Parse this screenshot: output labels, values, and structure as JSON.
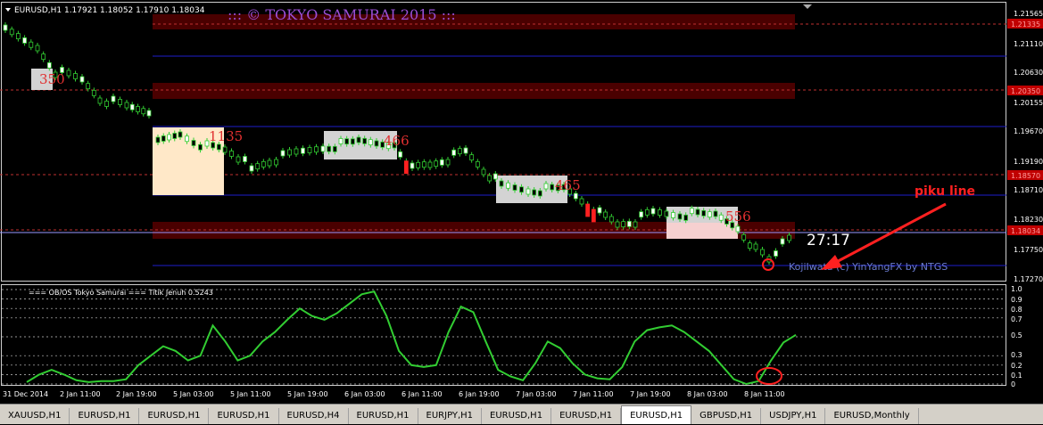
{
  "chart_header": {
    "title": "EURUSD,H1  1.17921 1.18052 1.17910 1.18034",
    "watermark": "::: © TOKYO SAMURAI 2015 :::",
    "menu_icon": "triangle-down-icon"
  },
  "price_axis": {
    "labels": [
      "1.21565",
      "1.21110",
      "1.20630",
      "1.20155",
      "1.19670",
      "1.19190",
      "1.18710",
      "1.18230",
      "1.17750",
      "1.17270"
    ],
    "badges": [
      "1.21335",
      "1.20350",
      "1.18570",
      "1.18034"
    ]
  },
  "box_labels": [
    "350",
    "1135",
    "466",
    "465",
    "556"
  ],
  "countdown": "27:17",
  "credit": "KojiIwata (c) YinYangFX by NTGS",
  "annotation": {
    "text": "piku line",
    "arrow_icon": "red-arrow-icon"
  },
  "indicator": {
    "title": "=== OB/OS Tokyo Samurai === Titik Jenuh 0.5243",
    "scale_labels": [
      "1.0",
      "0.9",
      "0.8",
      "0.7",
      "0.5",
      "0.3",
      "0.2",
      "0.1",
      "0"
    ],
    "level_markers": [
      1.0,
      0.9,
      0.8,
      0.7,
      0.5,
      0.3,
      0.2,
      0.1,
      0
    ],
    "line_color": "#32cd32",
    "curve": [
      0.02,
      0.1,
      0.15,
      0.1,
      0.04,
      0.02,
      0.03,
      0.03,
      0.05,
      0.2,
      0.3,
      0.4,
      0.35,
      0.25,
      0.3,
      0.62,
      0.45,
      0.25,
      0.3,
      0.45,
      0.55,
      0.68,
      0.8,
      0.72,
      0.68,
      0.75,
      0.85,
      0.95,
      0.98,
      0.72,
      0.35,
      0.2,
      0.18,
      0.2,
      0.55,
      0.82,
      0.76,
      0.45,
      0.15,
      0.08,
      0.04,
      0.22,
      0.45,
      0.38,
      0.22,
      0.1,
      0.06,
      0.05,
      0.18,
      0.45,
      0.57,
      0.6,
      0.62,
      0.55,
      0.45,
      0.35,
      0.2,
      0.05,
      0.0,
      0.03,
      0.25,
      0.44,
      0.52
    ]
  },
  "time_axis": [
    "31 Dec 2014",
    "2 Jan 11:00",
    "2 Jan 19:00",
    "5 Jan 03:00",
    "5 Jan 11:00",
    "5 Jan 19:00",
    "6 Jan 03:00",
    "6 Jan 11:00",
    "6 Jan 19:00",
    "7 Jan 03:00",
    "7 Jan 11:00",
    "7 Jan 19:00",
    "8 Jan 03:00",
    "8 Jan 11:00"
  ],
  "tabs": [
    "XAUUSD,H1",
    "EURUSD,H1",
    "EURUSD,H1",
    "EURUSD,H1",
    "EURUSD,H4",
    "EURUSD,H1",
    "EURJPY,H1",
    "EURUSD,H1",
    "EURUSD,H1",
    "EURUSD,H1",
    "GBPUSD,H1",
    "USDJPY,H1",
    "EURUSD,Monthly"
  ],
  "active_tab_index": 9,
  "colors": {
    "bull": "#32cd32",
    "bear": "#ff2020",
    "blue_line": "#1e1ecc",
    "red_zone": "#4a0000",
    "box_fill": "#d3d3d3",
    "peach": "#ffe8c8"
  }
}
